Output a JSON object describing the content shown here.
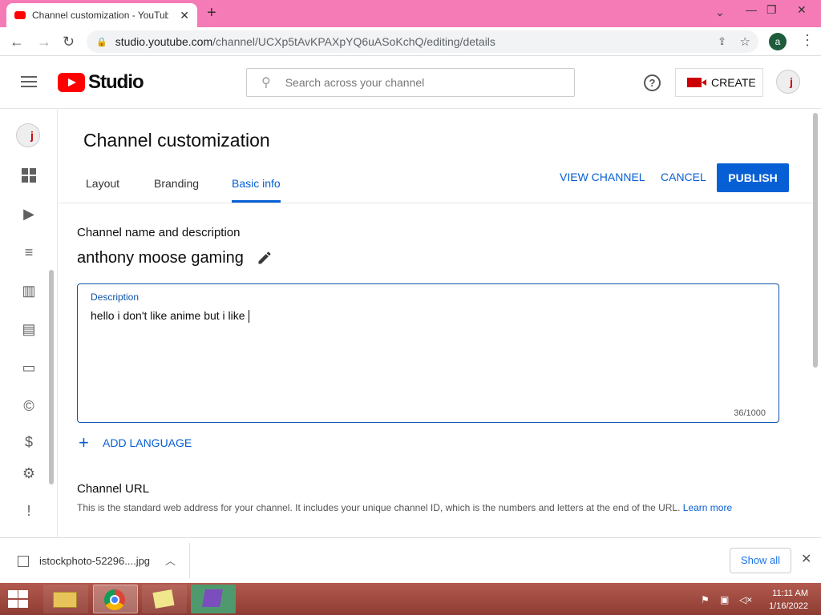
{
  "browser": {
    "tab_title": "Channel customization - YouTube",
    "tab_close": "✕",
    "new_tab": "+",
    "url_host": "studio.youtube.com",
    "url_path": "/channel/UCXp5tAvKPAXpYQ6uASoKchQ/editing/details",
    "account_initial": "a",
    "window_controls": [
      "⌄",
      "—",
      "❐",
      "✕"
    ]
  },
  "studio_header": {
    "logo_text": "Studio",
    "search_placeholder": "Search across your channel",
    "help": "?",
    "create_label": "CREATE"
  },
  "page": {
    "title": "Channel customization",
    "tabs": [
      {
        "label": "Layout",
        "active": false
      },
      {
        "label": "Branding",
        "active": false
      },
      {
        "label": "Basic info",
        "active": true
      }
    ],
    "actions": {
      "view_channel": "VIEW CHANNEL",
      "cancel": "CANCEL",
      "publish": "PUBLISH"
    },
    "name_section": {
      "label": "Channel name and description",
      "channel_name": "anthony moose gaming"
    },
    "description": {
      "label": "Description",
      "value": "hello i don't like anime but i like",
      "counter": "36/1000"
    },
    "add_language": "ADD LANGUAGE",
    "channel_url": {
      "title": "Channel URL",
      "text": "This is the standard web address for your channel. It includes your unique channel ID, which is the numbers and letters at the end of the URL.",
      "learn_more": "Learn more"
    }
  },
  "downloads": {
    "file_name": "istockphoto-52296....jpg",
    "show_all": "Show all",
    "close": "✕"
  },
  "taskbar": {
    "time": "11:11 AM",
    "date": "1/16/2022"
  },
  "colors": {
    "accent": "#065fd4",
    "tabbar": "#f57bb6",
    "yt_red": "#ff0000"
  }
}
